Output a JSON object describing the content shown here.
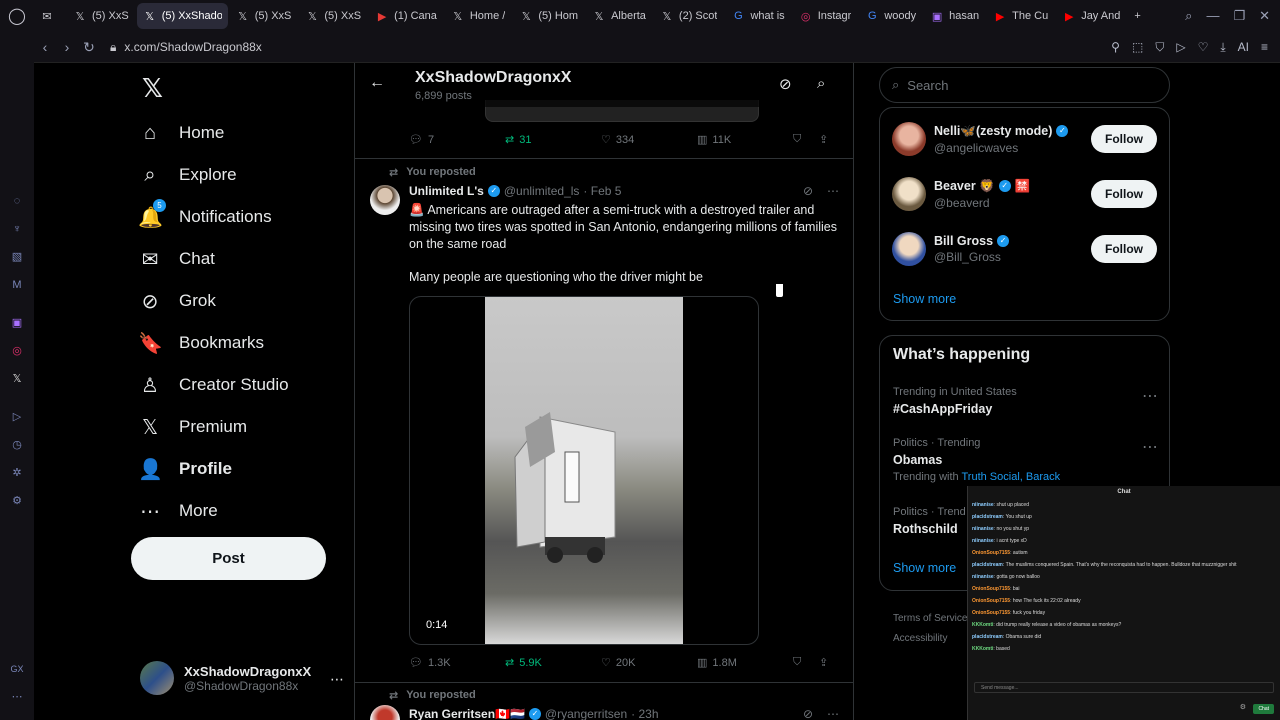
{
  "browser": {
    "tabs": [
      {
        "icon": "envelope-icon",
        "label": ""
      },
      {
        "icon": "x-logo-icon",
        "label": "(5) XxS"
      },
      {
        "icon": "x-logo-icon",
        "label": "(5) XxShadow",
        "active": true
      },
      {
        "icon": "x-logo-icon",
        "label": "(5) XxS"
      },
      {
        "icon": "x-logo-icon",
        "label": "(5) XxS"
      },
      {
        "icon": "video-icon",
        "label": "(1) Cana"
      },
      {
        "icon": "x-logo-icon",
        "label": "Home /"
      },
      {
        "icon": "x-logo-icon",
        "label": "(5) Hom"
      },
      {
        "icon": "x-logo-icon",
        "label": "Alberta"
      },
      {
        "icon": "x-logo-icon",
        "label": "(2) Scot"
      },
      {
        "icon": "google-icon",
        "label": "what is"
      },
      {
        "icon": "instagram-icon",
        "label": "Instagr"
      },
      {
        "icon": "google-icon",
        "label": "woody"
      },
      {
        "icon": "twitch-icon",
        "label": "hasan"
      },
      {
        "icon": "youtube-icon",
        "label": "The Cu"
      },
      {
        "icon": "youtube-icon",
        "label": "Jay And"
      }
    ],
    "url": "x.com/ShadowDragon88x",
    "ai_label": "AI"
  },
  "nav": {
    "items": [
      {
        "name": "home",
        "label": "Home",
        "icon": "⌂"
      },
      {
        "name": "explore",
        "label": "Explore",
        "icon": "⌕"
      },
      {
        "name": "notifications",
        "label": "Notifications",
        "icon": "🔔",
        "badge": "5"
      },
      {
        "name": "chat",
        "label": "Chat",
        "icon": "✉"
      },
      {
        "name": "grok",
        "label": "Grok",
        "icon": "⊘"
      },
      {
        "name": "bookmarks",
        "label": "Bookmarks",
        "icon": "🔖"
      },
      {
        "name": "creator-studio",
        "label": "Creator Studio",
        "icon": "♙"
      },
      {
        "name": "premium",
        "label": "Premium",
        "icon": "𝕏"
      },
      {
        "name": "profile",
        "label": "Profile",
        "icon": "👤"
      },
      {
        "name": "more",
        "label": "More",
        "icon": "⋯"
      }
    ],
    "post_label": "Post",
    "account_name": "XxShadowDragonxX",
    "account_handle": "@ShadowDragon88x"
  },
  "profile_header": {
    "title": "XxShadowDragonxX",
    "posts": "6,899 posts"
  },
  "prev_tweet_actions": {
    "replies": "7",
    "reposts": "31",
    "likes": "334",
    "views": "11K"
  },
  "tweet": {
    "repost_label": "You reposted",
    "name": "Unlimited L's",
    "handle": "@unlimited_ls",
    "date": "· Feb 5",
    "text1": "🚨 Americans are outraged after a semi-truck with a destroyed trailer and missing two tires was spotted in San Antonio, endangering millions of families on the same road",
    "text2": "Many people are questioning who the driver might be",
    "duration": "0:14",
    "replies": "1.3K",
    "reposts": "5.9K",
    "likes": "20K",
    "views": "1.8M"
  },
  "tweet2": {
    "repost_label": "You reposted",
    "name": "Ryan Gerritsen🇨🇦🇳🇱",
    "handle": "@ryangerritsen",
    "date": "· 23h"
  },
  "search_placeholder": "Search",
  "who_to_follow": [
    {
      "name": "Nelli🦋(zesty mode)",
      "handle": "@angelicwaves",
      "button": "Follow"
    },
    {
      "name": "Beaver 🦁",
      "handle": "@beaverd",
      "button": "Follow",
      "extra": "🈲"
    },
    {
      "name": "Bill Gross",
      "handle": "@Bill_Gross",
      "button": "Follow"
    }
  ],
  "show_more": "Show more",
  "happening": {
    "title": "What’s happening",
    "trends": [
      {
        "meta": "Trending in United States",
        "name": "#CashAppFriday"
      },
      {
        "meta": "Politics · Trending",
        "name": "Obamas",
        "with_label": "Trending with",
        "with_links": "Truth Social, Barack"
      },
      {
        "meta": "Politics · Trend",
        "name": "Rothschild"
      }
    ],
    "show_more": "Show more"
  },
  "footer": {
    "terms": "Terms of Service",
    "accessibility": "Accessibility"
  },
  "chat": {
    "title": "Chat",
    "messages": [
      {
        "user": "niinanise",
        "text": "shut up placed",
        "color": "blue"
      },
      {
        "user": "placidstream",
        "text": "You shut up",
        "color": "blue"
      },
      {
        "user": "niinanise",
        "text": "no you shut yp",
        "color": "blue"
      },
      {
        "user": "niinanise",
        "text": "i acnt type xD",
        "color": "blue"
      },
      {
        "user": "OnionSoup7155",
        "text": "autism",
        "color": "orange"
      },
      {
        "user": "placidstream",
        "text": "The muslims conquered Spain. That's why the reconquista had to happen. Bulldoze that muzznigger shit",
        "color": "blue"
      },
      {
        "user": "niinanise",
        "text": "gotta go now balloo",
        "color": "blue"
      },
      {
        "user": "OnionSoup7155",
        "text": "bai",
        "color": "orange"
      },
      {
        "user": "OnionSoup7155",
        "text": "how The fuck its 22:02 already",
        "color": "orange"
      },
      {
        "user": "OnionSoup7155",
        "text": "fuck you friday",
        "color": "orange"
      },
      {
        "user": "KKKomti",
        "text": "did trump really release a video of obamas as monkeys?",
        "color": "green"
      },
      {
        "user": "placidstream",
        "text": "Obama sure did",
        "color": "blue"
      },
      {
        "user": "KKKomti",
        "text": "based",
        "color": "green"
      }
    ],
    "input_placeholder": "Send message...",
    "chat_button": "Chat"
  }
}
